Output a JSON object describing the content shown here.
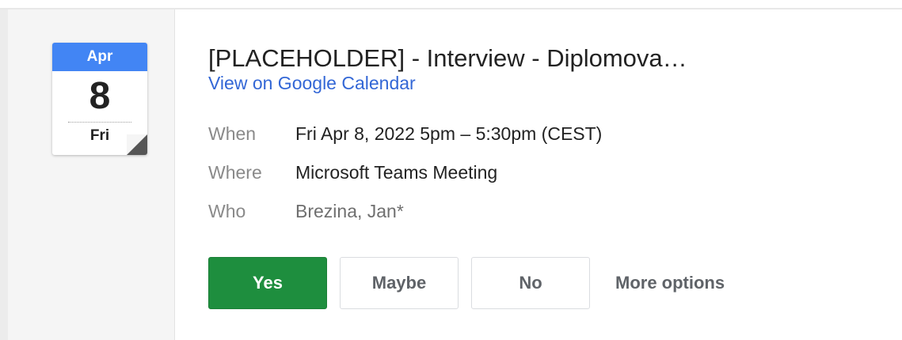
{
  "calendar_tile": {
    "month": "Apr",
    "day": "8",
    "weekday": "Fri"
  },
  "event": {
    "title": "[PLACEHOLDER] - Interview - Diplomova…",
    "gcal_link": "View on Google Calendar",
    "details": [
      {
        "label": "When",
        "value": "Fri Apr 8, 2022 5pm – 5:30pm (CEST)"
      },
      {
        "label": "Where",
        "value": "Microsoft Teams Meeting"
      },
      {
        "label": "Who",
        "value": "Brezina, Jan*"
      }
    ]
  },
  "rsvp": {
    "yes": "Yes",
    "maybe": "Maybe",
    "no": "No",
    "more_options": "More options"
  },
  "colors": {
    "accent_blue": "#4285f4",
    "link_blue": "#3367d6",
    "yes_green": "#1e8e3e"
  }
}
